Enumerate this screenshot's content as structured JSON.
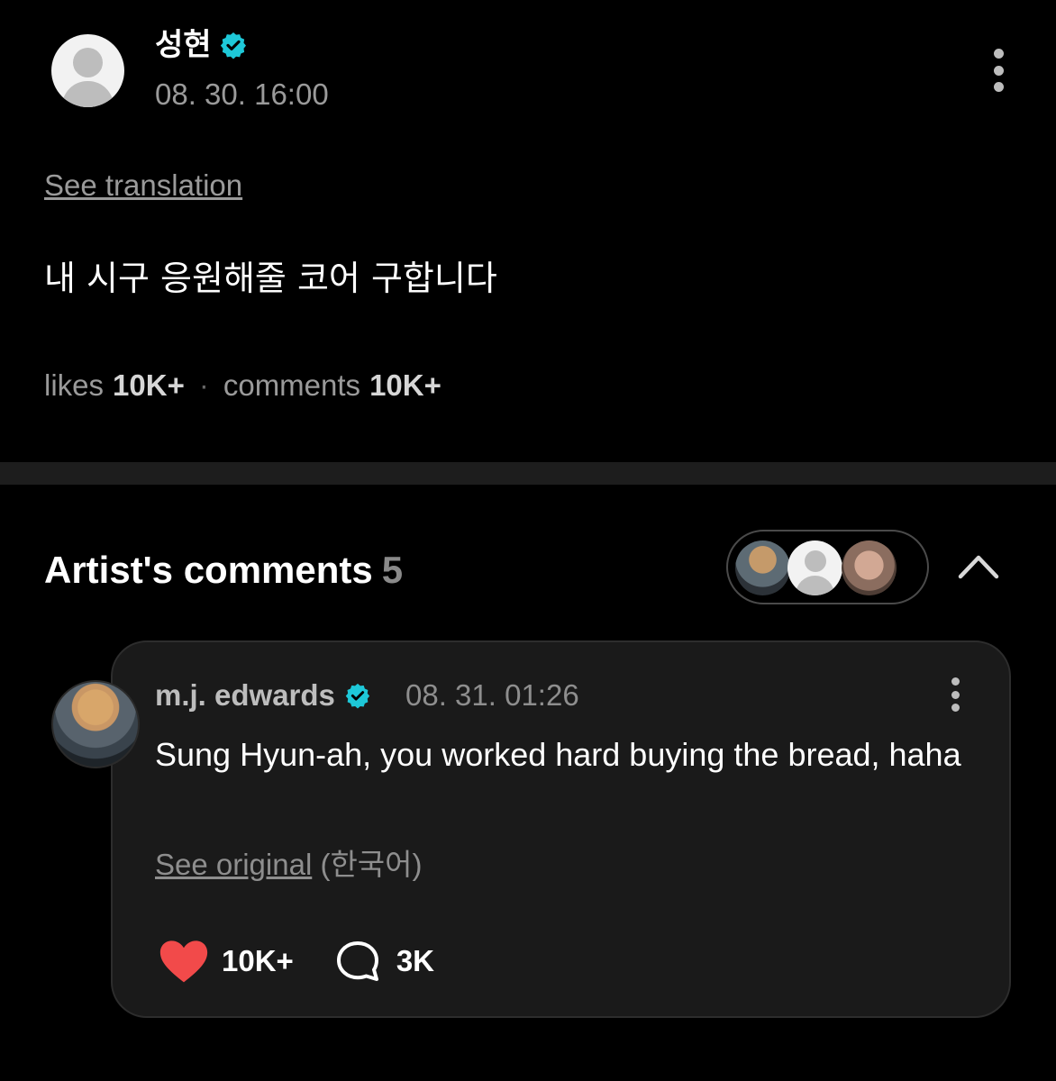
{
  "post": {
    "author": "성현",
    "date": "08. 30. 16:00",
    "see_translation": "See translation",
    "body": "내 시구 응원해줄 코어 구합니다",
    "likes_label": "likes",
    "likes_count": "10K+",
    "stats_separator": "·",
    "comments_label": "comments",
    "comments_count": "10K+"
  },
  "artist_comments": {
    "title": "Artist's comments",
    "count": "5"
  },
  "comment": {
    "author": "m.j. edwards",
    "date": "08. 31. 01:26",
    "text": "Sung Hyun-ah, you worked hard buying the bread, haha",
    "see_original": "See original",
    "original_language": "(한국어)",
    "likes": "10K+",
    "replies": "3K"
  },
  "colors": {
    "background": "#000000",
    "card": "#1a1a1a",
    "verified": "#1ec8d8",
    "heart": "#f24a4a",
    "muted_text": "#9a9a9a"
  },
  "icons": [
    "verified-badge-icon",
    "more-vertical-icon",
    "chevron-up-icon",
    "heart-icon",
    "comment-bubble-icon"
  ]
}
